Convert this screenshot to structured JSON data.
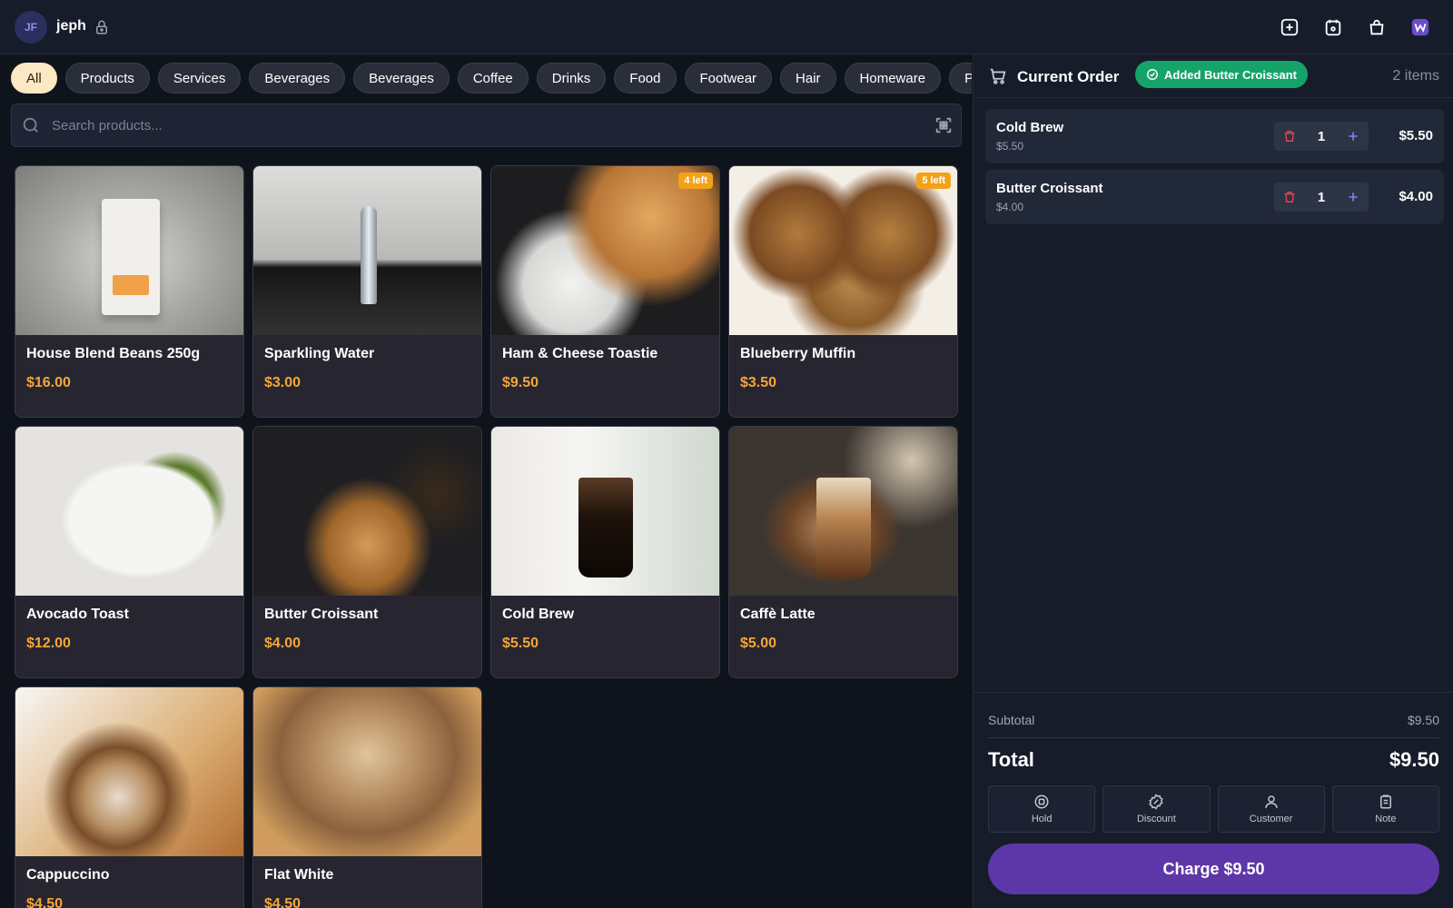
{
  "header": {
    "avatar_initials": "JF",
    "username": "jeph",
    "icons": [
      "lock-icon",
      "add-square-icon",
      "calendar-icon",
      "bag-icon",
      "app-logo-icon"
    ]
  },
  "categories": [
    "All",
    "Products",
    "Services",
    "Beverages",
    "Beverages",
    "Coffee",
    "Drinks",
    "Food",
    "Footwear",
    "Hair",
    "Homeware",
    "Pants"
  ],
  "active_category": "All",
  "search": {
    "placeholder": "Search products..."
  },
  "products": [
    {
      "name": "House Blend Beans 250g",
      "price": "$16.00",
      "badge": ""
    },
    {
      "name": "Sparkling Water",
      "price": "$3.00",
      "badge": ""
    },
    {
      "name": "Ham & Cheese Toastie",
      "price": "$9.50",
      "badge": "4 left"
    },
    {
      "name": "Blueberry Muffin",
      "price": "$3.50",
      "badge": "5 left"
    },
    {
      "name": "Avocado Toast",
      "price": "$12.00",
      "badge": ""
    },
    {
      "name": "Butter Croissant",
      "price": "$4.00",
      "badge": ""
    },
    {
      "name": "Cold Brew",
      "price": "$5.50",
      "badge": ""
    },
    {
      "name": "Caffè Latte",
      "price": "$5.00",
      "badge": ""
    },
    {
      "name": "Cappuccino",
      "price": "$4.50",
      "badge": ""
    },
    {
      "name": "Flat White",
      "price": "$4.50",
      "badge": ""
    }
  ],
  "order": {
    "title": "Current Order",
    "toast": "Added Butter Croissant",
    "item_count": "2 items",
    "lines": [
      {
        "name": "Cold Brew",
        "unit_price": "$5.50",
        "qty": "1",
        "total": "$5.50"
      },
      {
        "name": "Butter Croissant",
        "unit_price": "$4.00",
        "qty": "1",
        "total": "$4.00"
      }
    ],
    "subtotal_label": "Subtotal",
    "subtotal": "$9.50",
    "total_label": "Total",
    "total": "$9.50",
    "actions": [
      "Hold",
      "Discount",
      "Customer",
      "Note"
    ],
    "charge_label": "Charge $9.50"
  },
  "colors": {
    "accent_price": "#f3a73a",
    "toast_green": "#16a36a",
    "charge_purple": "#5d37a8",
    "stock_badge": "#f3a218"
  }
}
